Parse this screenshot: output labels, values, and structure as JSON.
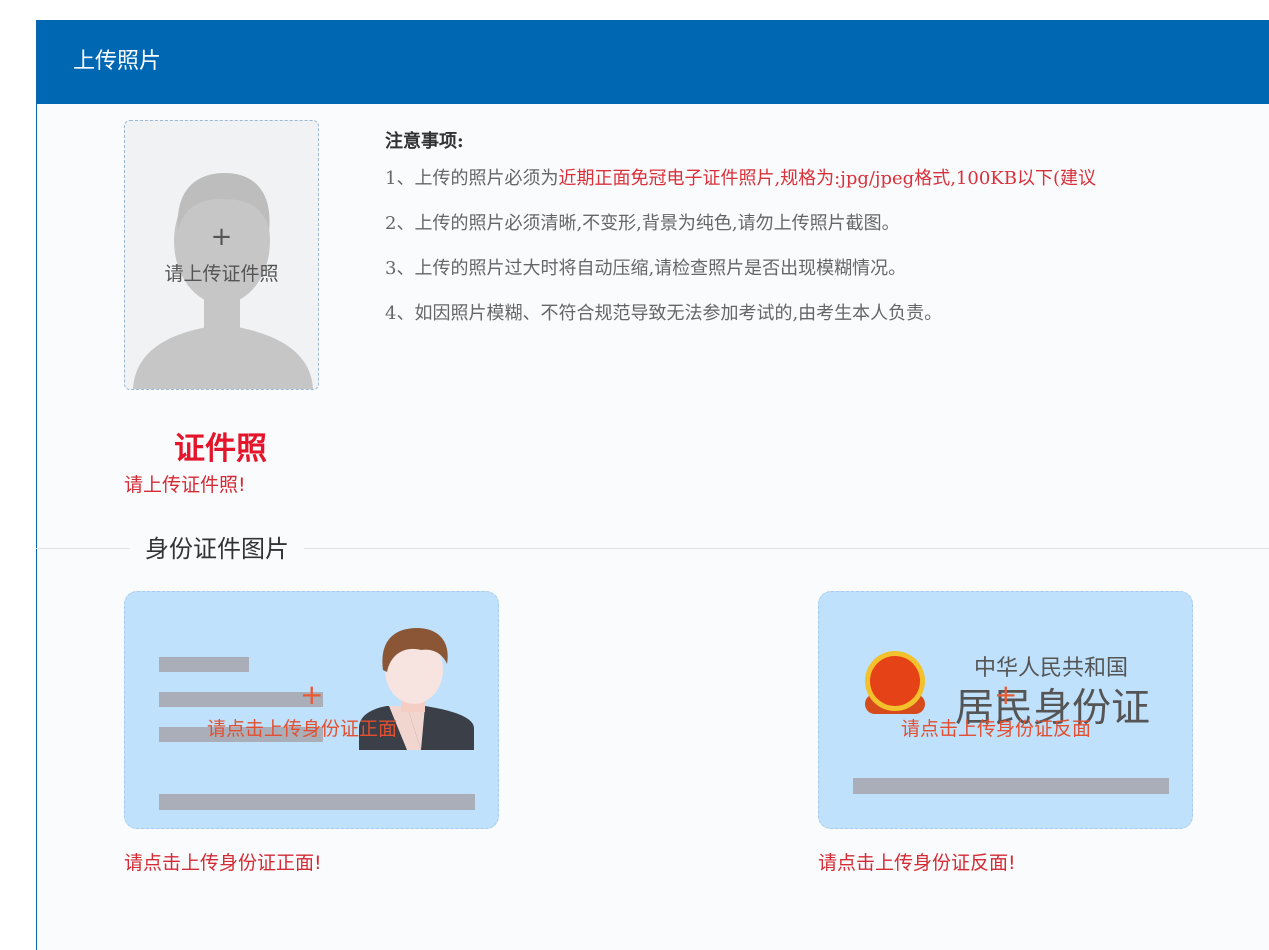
{
  "header": {
    "title": "上传照片"
  },
  "photo": {
    "plus": "+",
    "upload_label": "请上传证件照",
    "caption": "证件照",
    "error": "请上传证件照!"
  },
  "notes": {
    "title": "注意事项:",
    "line1_prefix": "1、上传的照片必须为",
    "line1_red": "近期正面免冠电子证件照片,规格为:jpg/jpeg格式,100KB以下(建议",
    "line2": "2、上传的照片必须清晰,不变形,背景为纯色,请勿上传照片截图。",
    "line3": "3、上传的照片过大时将自动压缩,请检查照片是否出现模糊情况。",
    "line4": "4、如因照片模糊、不符合规范导致无法参加考试的,由考生本人负责。"
  },
  "id_section": {
    "title": "身份证件图片",
    "front": {
      "plus": "+",
      "label": "请点击上传身份证正面",
      "error": "请点击上传身份证正面!"
    },
    "back": {
      "plus": "+",
      "label": "请点击上传身份证反面",
      "emblem_line1": "中华人民共和国",
      "emblem_line2": "居民身份证",
      "error": "请点击上传身份证反面!"
    }
  },
  "colors": {
    "header_bg": "#0067b3",
    "accent_red": "#e4142b",
    "card_bg": "#bfe1fc"
  }
}
